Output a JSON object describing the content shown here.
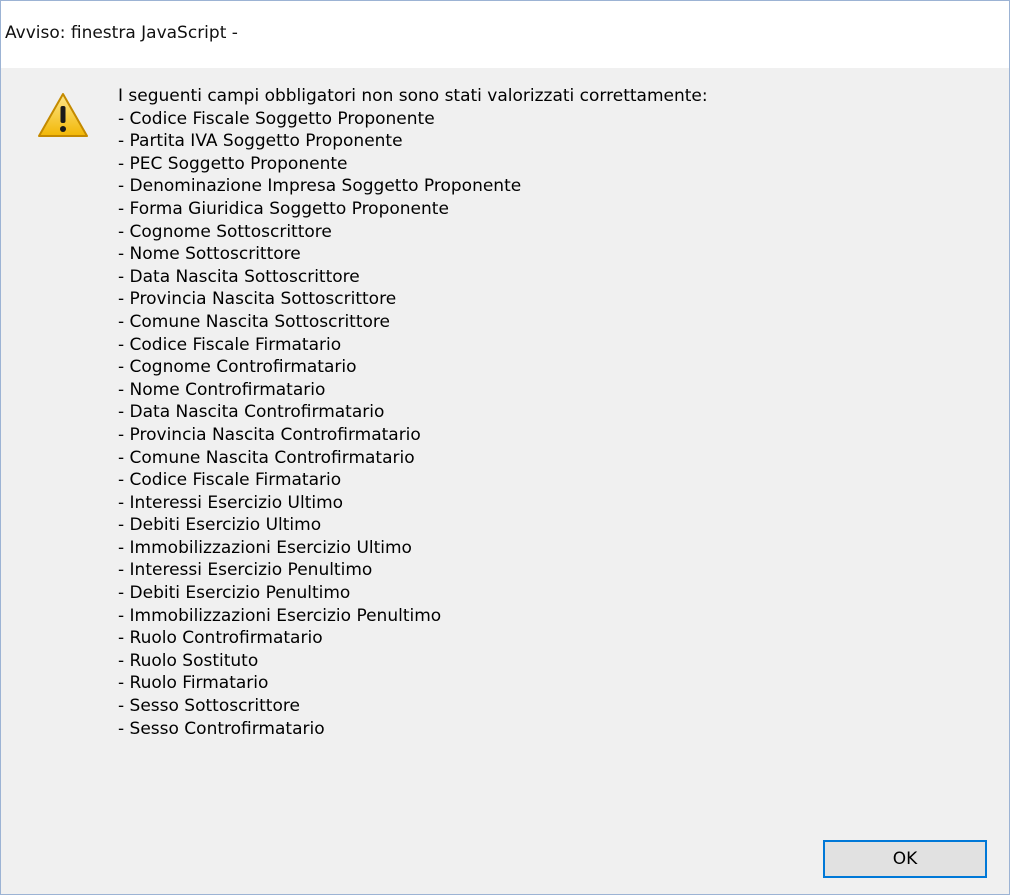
{
  "dialog": {
    "title": "Avviso: finestra JavaScript -",
    "icon": "warning-icon",
    "intro": "I seguenti campi obbligatori non sono stati valorizzati correttamente:",
    "fields": [
      "- Codice Fiscale Soggetto Proponente",
      "- Partita IVA Soggetto Proponente",
      "- PEC Soggetto Proponente",
      "- Denominazione Impresa Soggetto Proponente",
      "- Forma Giuridica Soggetto Proponente",
      "- Cognome Sottoscrittore",
      "- Nome Sottoscrittore",
      "- Data Nascita Sottoscrittore",
      "- Provincia Nascita Sottoscrittore",
      "- Comune Nascita Sottoscrittore",
      "- Codice Fiscale Firmatario",
      "- Cognome Controfirmatario",
      "- Nome Controfirmatario",
      "- Data Nascita Controfirmatario",
      "- Provincia Nascita Controfirmatario",
      "- Comune Nascita Controfirmatario",
      "- Codice Fiscale Firmatario",
      "- Interessi Esercizio Ultimo",
      "- Debiti Esercizio Ultimo",
      "- Immobilizzazioni Esercizio Ultimo",
      "- Interessi Esercizio Penultimo",
      "- Debiti Esercizio Penultimo",
      "- Immobilizzazioni Esercizio Penultimo",
      "- Ruolo Controfirmatario",
      "- Ruolo Sostituto",
      "- Ruolo Firmatario",
      "- Sesso Sottoscrittore",
      "- Sesso Controfirmatario"
    ],
    "ok_label": "OK"
  },
  "colors": {
    "window_background": "#f0f0f0",
    "titlebar_background": "#ffffff",
    "button_focus_border": "#0078d7",
    "warning_fill": "#f5c518"
  }
}
